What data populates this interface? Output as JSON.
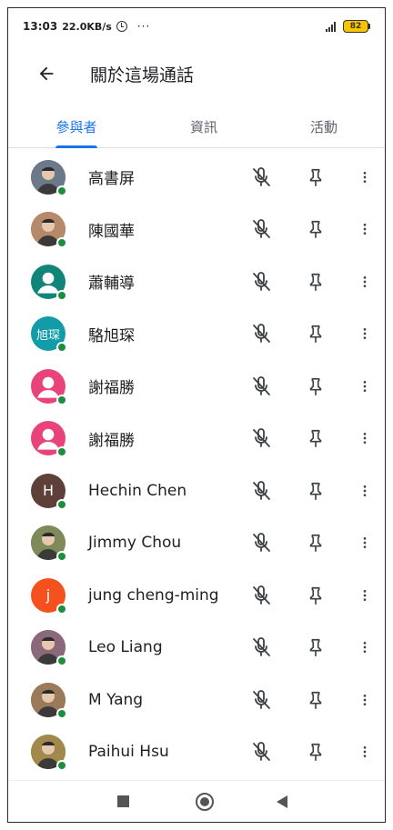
{
  "status_bar": {
    "time": "13:03",
    "speed": "22.0KB/s",
    "more": "···",
    "battery": "82"
  },
  "header": {
    "title": "關於這場通話"
  },
  "tabs": [
    {
      "label": "參與者",
      "active": true
    },
    {
      "label": "資訊",
      "active": false
    },
    {
      "label": "活動",
      "active": false
    }
  ],
  "participants": [
    {
      "name": "高書屏",
      "avatar": "photo",
      "avatar_color": "#6b7a8a"
    },
    {
      "name": "陳國華",
      "avatar": "photo",
      "avatar_color": "#b7896b"
    },
    {
      "name": "蕭輔導",
      "avatar": "person-icon",
      "avatar_color": "#12857a"
    },
    {
      "name": "駱旭琛",
      "avatar_text": "旭琛",
      "avatar_color": "#129ca8"
    },
    {
      "name": "謝福勝",
      "avatar": "person-icon",
      "avatar_color": "#e8437a"
    },
    {
      "name": "謝福勝",
      "avatar": "person-icon",
      "avatar_color": "#e8437a"
    },
    {
      "name": "Hechin Chen",
      "avatar_text": "H",
      "avatar_color": "#5d4037"
    },
    {
      "name": "Jimmy Chou",
      "avatar": "photo",
      "avatar_color": "#7e8a5a"
    },
    {
      "name": "jung cheng-ming",
      "avatar_text": "j",
      "avatar_color": "#f4511e"
    },
    {
      "name": "Leo Liang",
      "avatar": "photo",
      "avatar_color": "#8a6a7a"
    },
    {
      "name": "M Yang",
      "avatar": "photo",
      "avatar_color": "#9a7a5a"
    },
    {
      "name": "Paihui Hsu",
      "avatar": "photo",
      "avatar_color": "#a0894a"
    }
  ],
  "icons": {
    "back": "arrow-left-icon",
    "mic": "mic-off-icon",
    "pin": "pin-icon",
    "more": "more-vert-icon",
    "presence": "green-dot",
    "presence_color": "#1e8e3e",
    "accent_color": "#1a73e8"
  }
}
